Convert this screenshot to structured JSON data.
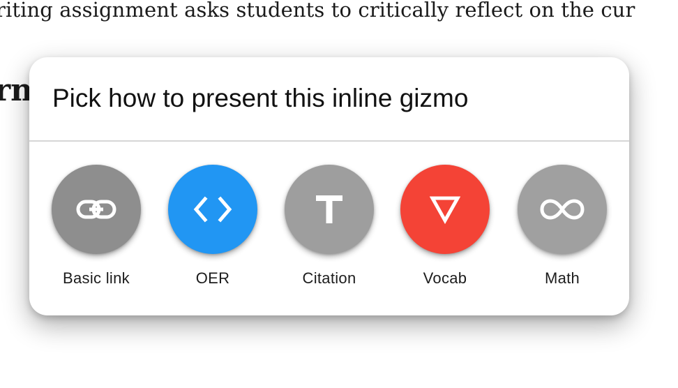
{
  "background": {
    "text_line": "riting assignment asks students to critically reflect on the cur",
    "heading_fragment": "rn"
  },
  "dialog": {
    "title": "Pick how to present this inline gizmo",
    "options": [
      {
        "label": "Basic link",
        "icon": "link-icon",
        "color": "#8e8e8e"
      },
      {
        "label": "OER",
        "icon": "code-icon",
        "color": "#2196f3"
      },
      {
        "label": "Citation",
        "icon": "text-t-icon",
        "color": "#9e9e9e"
      },
      {
        "label": "Vocab",
        "icon": "triangle-down-icon",
        "color": "#f44336"
      },
      {
        "label": "Math",
        "icon": "infinity-icon",
        "color": "#a0a0a0"
      }
    ]
  }
}
